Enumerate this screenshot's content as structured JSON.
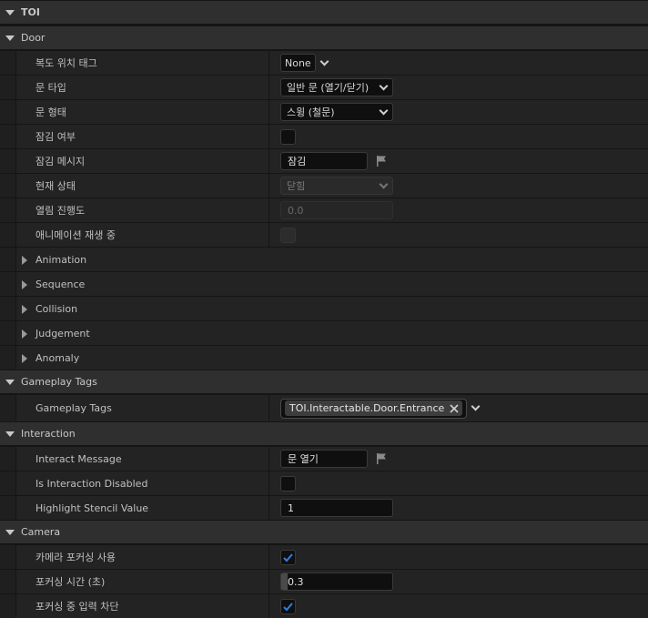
{
  "sections": {
    "toi": "TOI",
    "door": "Door",
    "gameplay_tags": "Gameplay Tags",
    "interaction": "Interaction",
    "camera": "Camera"
  },
  "door": {
    "corridor_tag": {
      "label": "복도 위치 태그",
      "value": "None"
    },
    "door_type": {
      "label": "문 타입",
      "value": "일반 문 (열기/닫기)"
    },
    "door_shape": {
      "label": "문 형태",
      "value": "스윙 (철문)"
    },
    "is_locked": {
      "label": "잠김 여부",
      "checked": false
    },
    "lock_message": {
      "label": "잠김 메시지",
      "value": "잠김"
    },
    "current_state": {
      "label": "현재 상태",
      "value": "닫힘"
    },
    "open_progress": {
      "label": "열림 진행도",
      "value": "0.0"
    },
    "anim_playing": {
      "label": "애니메이션 재생 중",
      "checked": false
    }
  },
  "subsections": [
    "Animation",
    "Sequence",
    "Collision",
    "Judgement",
    "Anomaly"
  ],
  "gameplay_tags": {
    "label": "Gameplay Tags",
    "tag": "TOI.Interactable.Door.Entrance"
  },
  "interaction": {
    "message": {
      "label": "Interact Message",
      "value": "문 열기"
    },
    "disabled": {
      "label": "Is Interaction Disabled",
      "checked": false
    },
    "stencil": {
      "label": "Highlight Stencil Value",
      "value": "1"
    }
  },
  "camera": {
    "use_focus": {
      "label": "카메라 포커싱 사용",
      "checked": true
    },
    "focus_time": {
      "label": "포커싱 시간 (초)",
      "value": "0.3"
    },
    "block_input": {
      "label": "포커싱 중 입력 차단",
      "checked": true
    }
  },
  "colors": {
    "accent": "#2f7fe0",
    "panel": "#232323",
    "header": "#2f2f2f"
  }
}
